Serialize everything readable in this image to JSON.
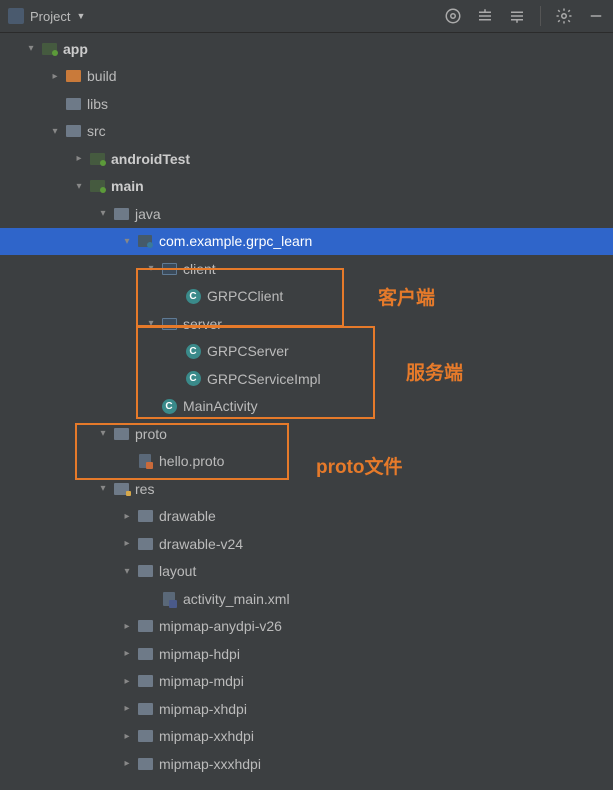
{
  "header": {
    "title": "Project"
  },
  "annotations": {
    "client": "客户端",
    "server": "服务端",
    "proto": "proto文件"
  },
  "tree": {
    "app": "app",
    "build": "build",
    "libs": "libs",
    "src": "src",
    "androidTest": "androidTest",
    "main": "main",
    "java": "java",
    "package": "com.example.grpc_learn",
    "client": "client",
    "grpcClient": "GRPCClient",
    "server": "server",
    "grpcServer": "GRPCServer",
    "grpcServiceImpl": "GRPCServiceImpl",
    "mainActivity": "MainActivity",
    "proto": "proto",
    "helloProto": "hello.proto",
    "res": "res",
    "drawable": "drawable",
    "drawableV24": "drawable-v24",
    "layout": "layout",
    "activityMain": "activity_main.xml",
    "mipmapAnydpiV26": "mipmap-anydpi-v26",
    "mipmapHdpi": "mipmap-hdpi",
    "mipmapMdpi": "mipmap-mdpi",
    "mipmapXhdpi": "mipmap-xhdpi",
    "mipmapXxhdpi": "mipmap-xxhdpi",
    "mipmapXxxhdpi": "mipmap-xxxhdpi"
  }
}
